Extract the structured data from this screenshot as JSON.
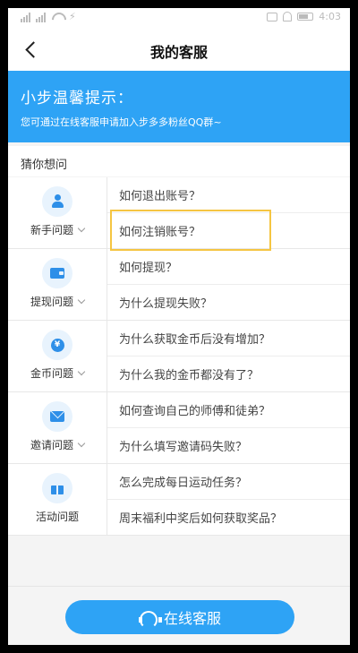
{
  "status_bar": {
    "time": "4:03"
  },
  "header": {
    "title": "我的客服"
  },
  "banner": {
    "title": "小步温馨提示：",
    "subtitle": "您可通过在线客服申请加入步多多粉丝QQ群~"
  },
  "section": {
    "title": "猜你想问"
  },
  "groups": [
    {
      "label": "新手问题",
      "icon": "person-icon",
      "questions": [
        "如何退出账号？",
        "如何注销账号？"
      ]
    },
    {
      "label": "提现问题",
      "icon": "wallet-icon",
      "questions": [
        "如何提现？",
        "为什么提现失败？"
      ]
    },
    {
      "label": "金币问题",
      "icon": "coin-icon",
      "icon_text": "¥",
      "questions": [
        "为什么获取金币后没有增加？",
        "为什么我的金币都没有了？"
      ]
    },
    {
      "label": "邀请问题",
      "icon": "mail-icon",
      "questions": [
        "如何查询自己的师傅和徒弟？",
        "为什么填写邀请码失败？"
      ]
    },
    {
      "label": "活动问题",
      "icon": "gift-icon",
      "questions": [
        "怎么完成每日运动任务？",
        "周末福利中奖后如何获取奖品？"
      ]
    }
  ],
  "cta": {
    "label": "在线客服"
  },
  "colors": {
    "accent": "#2ea3f5",
    "highlight_box": "#f5c542"
  }
}
